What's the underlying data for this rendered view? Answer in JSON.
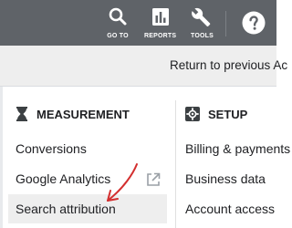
{
  "topbar": {
    "goto_label": "GO TO",
    "reports_label": "REPORTS",
    "tools_label": "TOOLS",
    "background": "#5f6368"
  },
  "subbar": {
    "return_text": "Return to previous Ac"
  },
  "measurement": {
    "heading": "MEASUREMENT",
    "items": [
      {
        "label": "Conversions"
      },
      {
        "label": "Google Analytics"
      },
      {
        "label": "Search attribution"
      }
    ]
  },
  "setup": {
    "heading": "SETUP",
    "items": [
      {
        "label": "Billing & payments"
      },
      {
        "label": "Business data"
      },
      {
        "label": "Account access"
      }
    ]
  },
  "colors": {
    "arrow": "#d32f2f",
    "highlight": "#eeeeee"
  }
}
